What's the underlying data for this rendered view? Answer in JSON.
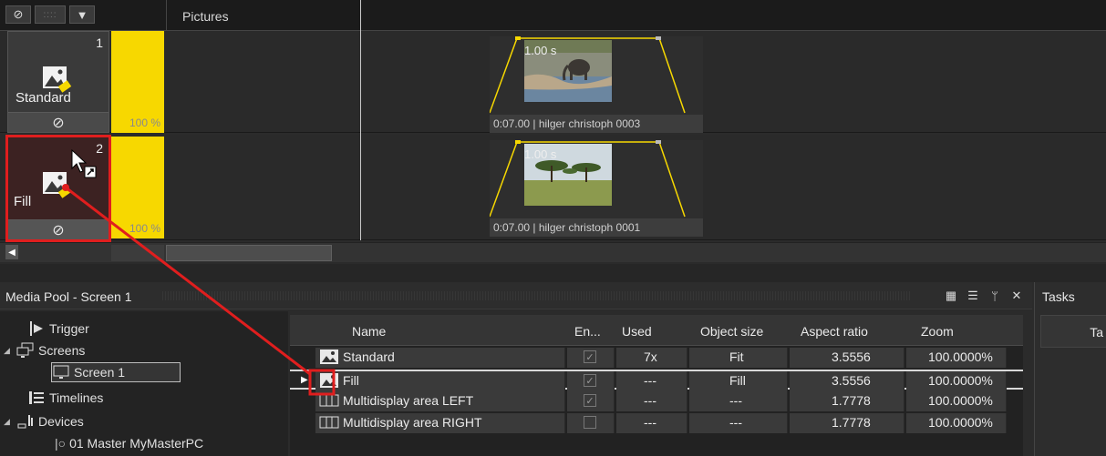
{
  "timeline": {
    "header": {
      "track_title": "Pictures",
      "tools": [
        "⊘",
        "::::",
        "▼"
      ]
    },
    "tracks": [
      {
        "number": "1",
        "name": "Standard",
        "opacity_label": "100 %",
        "opacity": 1.0,
        "footer_icon": "⊘",
        "clip": {
          "duration": "1.00 s",
          "caption": "0:07.00 | hilger christoph 0003",
          "photo": "elephant-photo"
        }
      },
      {
        "number": "2",
        "name": "Fill",
        "opacity_label": "100 %",
        "opacity": 1.0,
        "footer_icon": "⊘",
        "clip": {
          "duration": "1.00 s",
          "caption": "0:07.00 | hilger christoph 0001",
          "photo": "savanna-trees-photo"
        }
      }
    ]
  },
  "media_pool": {
    "title": "Media Pool - Screen 1",
    "header_icons": [
      "grid-view-icon",
      "list-view-icon",
      "pin-icon",
      "close-icon"
    ],
    "tree": [
      {
        "label": "Trigger",
        "icon": "trigger-icon",
        "expander": ""
      },
      {
        "label": "Screens",
        "icon": "screens-icon",
        "expander": "◢"
      },
      {
        "label": "Screen 1",
        "icon": "screen-icon",
        "expander": "",
        "selected": true
      },
      {
        "label": "Timelines",
        "icon": "timelines-icon",
        "expander": ""
      },
      {
        "label": "Devices",
        "icon": "devices-icon",
        "expander": "◢"
      },
      {
        "label": "01 Master MyMasterPC",
        "icon": "device-master-icon",
        "expander": ""
      }
    ],
    "columns": [
      "Name",
      "En...",
      "Used",
      "Object size",
      "Aspect ratio",
      "Zoom"
    ],
    "rows": [
      {
        "name": "Standard",
        "icon": "picture-icon",
        "enabled": true,
        "used": "7x",
        "object_size": "Fit",
        "aspect_ratio": "3.5556",
        "zoom": "100.0000%"
      },
      {
        "name": "Fill",
        "icon": "picture-icon",
        "enabled": true,
        "used": "---",
        "object_size": "Fill",
        "aspect_ratio": "3.5556",
        "zoom": "100.0000%",
        "selected": true
      },
      {
        "name": "Multidisplay area LEFT",
        "icon": "multidisplay-icon",
        "enabled": true,
        "used": "---",
        "object_size": "---",
        "aspect_ratio": "1.7778",
        "zoom": "100.0000%"
      },
      {
        "name": "Multidisplay area RIGHT",
        "icon": "multidisplay-icon",
        "enabled": false,
        "used": "---",
        "object_size": "---",
        "aspect_ratio": "1.7778",
        "zoom": "100.0000%"
      }
    ]
  },
  "tasks": {
    "title": "Tasks",
    "column": "Ta"
  },
  "colors": {
    "accent_yellow": "#f7d800",
    "annotation_red": "#e01e1e"
  }
}
